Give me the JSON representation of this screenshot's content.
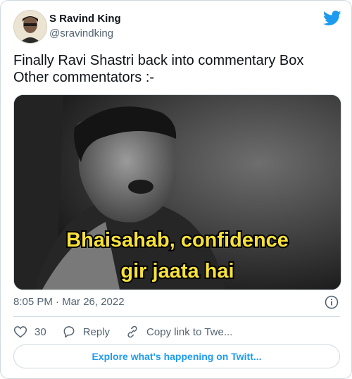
{
  "author": {
    "name": "S Ravind King",
    "handle": "@sravindking"
  },
  "tweet": {
    "text_line1": "Finally Ravi Shastri back into commentary Box",
    "text_line2": "Other commentators :-"
  },
  "media": {
    "caption_line1": "Bhaisahab, confidence",
    "caption_line2": "gir jaata hai"
  },
  "timestamp": "8:05 PM · Mar 26, 2022",
  "actions": {
    "like_count": "30",
    "reply_label": "Reply",
    "copy_link_label": "Copy link to Twe..."
  },
  "explore_label": "Explore what's happening on Twitt...",
  "colors": {
    "brand": "#1d9bf0",
    "secondary_text": "#536471",
    "border": "#cfd9de"
  },
  "icons": [
    "twitter-bird-icon",
    "info-icon",
    "heart-icon",
    "reply-icon",
    "link-icon"
  ]
}
